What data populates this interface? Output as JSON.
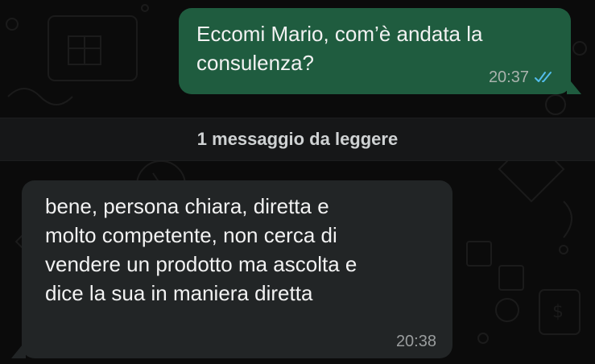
{
  "chat": {
    "messages": [
      {
        "direction": "outgoing",
        "lines": [
          "Eccomi Mario, com’è andata la",
          "consulenza?"
        ],
        "time": "20:37",
        "status_icon": "double-check-read-icon",
        "bubble_color": "#1f5c3f"
      },
      {
        "direction": "incoming",
        "lines": [
          "bene, persona chiara, diretta e",
          "molto competente, non cerca di",
          "vendere un prodotto ma ascolta e",
          "dice la sua in maniera diretta"
        ],
        "time": "20:38",
        "bubble_color": "#222526"
      }
    ],
    "unread_divider": {
      "label": "1 messaggio da leggere"
    }
  },
  "colors": {
    "background": "#0b0b0b",
    "read_ticks": "#53bdeb",
    "text": "#f2f2f2"
  }
}
